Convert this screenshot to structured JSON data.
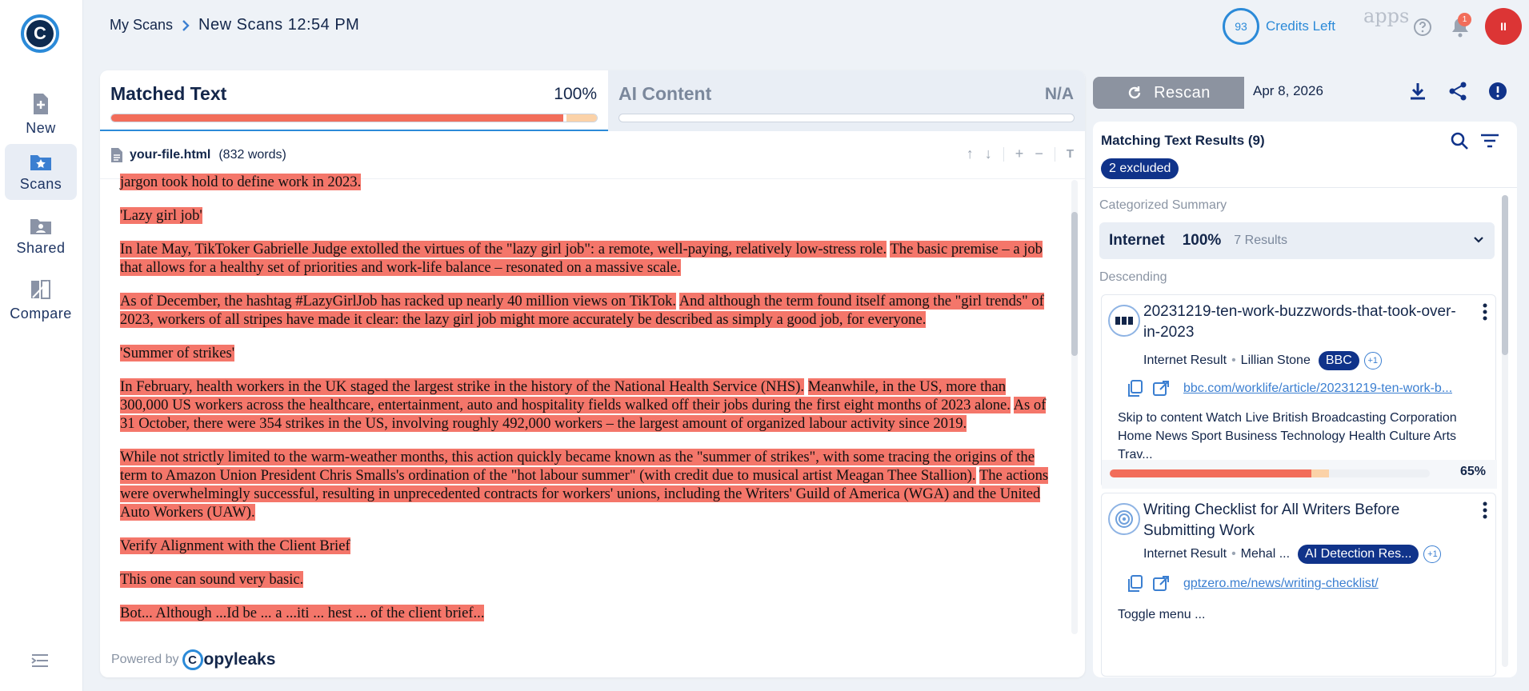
{
  "brand": {
    "logo_letter": "C",
    "powered_by": "Powered by",
    "powered_brand": "opyleaks",
    "powered_letter": "C"
  },
  "nav": [
    {
      "label": "New",
      "icon": "new-document-icon"
    },
    {
      "label": "Scans",
      "icon": "scans-star-icon",
      "active": true
    },
    {
      "label": "Shared",
      "icon": "shared-folder-icon"
    },
    {
      "label": "Compare",
      "icon": "compare-icon"
    }
  ],
  "breadcrumb": {
    "parent": "My Scans",
    "current": "New Scans 12:54 PM"
  },
  "topbar": {
    "credits_value": "93",
    "credits_label": "Credits Left",
    "apps_label": "apps",
    "notifications_count": "1",
    "avatar_initials": "II"
  },
  "tabs": {
    "matched": {
      "title": "Matched Text",
      "percent": "100%",
      "bar_fraction": 1.0
    },
    "ai": {
      "title": "AI Content",
      "percent": "N/A"
    }
  },
  "file": {
    "name": "your-file.html",
    "words": "(832 words)"
  },
  "document": {
    "paragraphs": [
      [
        {
          "t": "jargon took hold to define work in 2023.",
          "h": true
        }
      ],
      [
        {
          "t": "'Lazy girl job'",
          "h": true
        }
      ],
      [
        {
          "t": "In late May, TikToker Gabrielle Judge extolled the virtues of the \"lazy girl job\": a remote, well-paying, relatively low-stress role.",
          "h": true
        },
        {
          "t": " ",
          "h": false
        },
        {
          "t": "The basic premise",
          "h": true
        },
        {
          "t": " – a job that allows for a healthy set of priorities and work-life balance ",
          "h": true
        },
        {
          "t": "– resonated on a massive scale.",
          "h": true
        }
      ],
      [
        {
          "t": "As of December, the hashtag #LazyGirlJob has racked up nearly 40 million views on TikTok.",
          "h": true
        },
        {
          "t": " ",
          "h": false
        },
        {
          "t": "And although the term found itself among the \"girl trends\" of 2023, workers of all stripes have made it clear: the lazy girl job might more accurately be described as simply a good job, for everyone.",
          "h": true
        }
      ],
      [
        {
          "t": "'Summer of strikes'",
          "h": true
        }
      ],
      [
        {
          "t": "In February, health workers in the UK staged the largest strike in the history of the National Health Service (NHS).",
          "h": true
        },
        {
          "t": " ",
          "h": false
        },
        {
          "t": "Meanwhile, in the US, more than 300,000 US workers across the healthcare, entertainment, auto and hospitality fields walked off their jobs during the first eight months of 2023 alone.",
          "h": true
        },
        {
          "t": " ",
          "h": false
        },
        {
          "t": "As of 31 October, there were 354 strikes in the US, involving roughly 492,000 workers",
          "h": true
        },
        {
          "t": " – the largest amount of organized labour activity since 2019.",
          "h": true
        }
      ],
      [
        {
          "t": "While not strictly limited to the warm-weather months, this action quickly became known as the \"summer of strikes\", with some tracing the origins of the term to Amazon Union President Chris Smalls's ordination of the \"hot labour summer\" (with credit due to musical artist Meagan Thee Stallion).",
          "h": true
        },
        {
          "t": " ",
          "h": false
        },
        {
          "t": "The actions were overwhelmingly successful, resulting in unprecedented contracts for workers' unions, including the Writers' Guild of America (WGA) and the United Auto Workers (UAW).",
          "h": true
        }
      ],
      [
        {
          "t": "Verify Alignment with the Client Brief",
          "h": true
        }
      ],
      [
        {
          "t": "This one can sound very basic.",
          "h": true
        }
      ],
      [
        {
          "t": "Bot... Although ...Id be ... a ...iti ... hest ... of the client brief... ",
          "h": true
        }
      ]
    ]
  },
  "right": {
    "rescan_label": "Rescan",
    "date": "Apr 8, 2026",
    "results_title": "Matching Text Results (9)",
    "excluded": "2 excluded",
    "categorized_label": "Categorized Summary",
    "category": {
      "name": "Internet",
      "percent": "100%",
      "count": "7 Results"
    },
    "sort_label": "Descending",
    "cards": [
      {
        "title": "20231219-ten-work-buzzwords-that-took-over-in-2023",
        "type": "Internet Result",
        "author": "Lillian Stone",
        "tag": "BBC",
        "more": "+1",
        "url": "bbc.com/worklife/article/20231219-ten-work-b...",
        "snippet": "Skip to content Watch Live British Broadcasting Corporation Home News Sport Business Technology Health Culture Arts Trav...",
        "percent": "65%",
        "match_fraction": 0.65,
        "icon": "bbc-source-icon"
      },
      {
        "title": "Writing Checklist for All Writers Before Submitting Work",
        "type": "Internet Result",
        "author": "Mehal ...",
        "tag": "AI Detection Res...",
        "more": "+1",
        "url": "gptzero.me/news/writing-checklist/",
        "snippet": "Toggle menu ...",
        "icon": "gptzero-source-icon"
      }
    ]
  },
  "colors": {
    "accent": "#2b8ad8",
    "highlight": "#f4766a",
    "navy": "#10338a",
    "partial": "#fbd2a8"
  }
}
